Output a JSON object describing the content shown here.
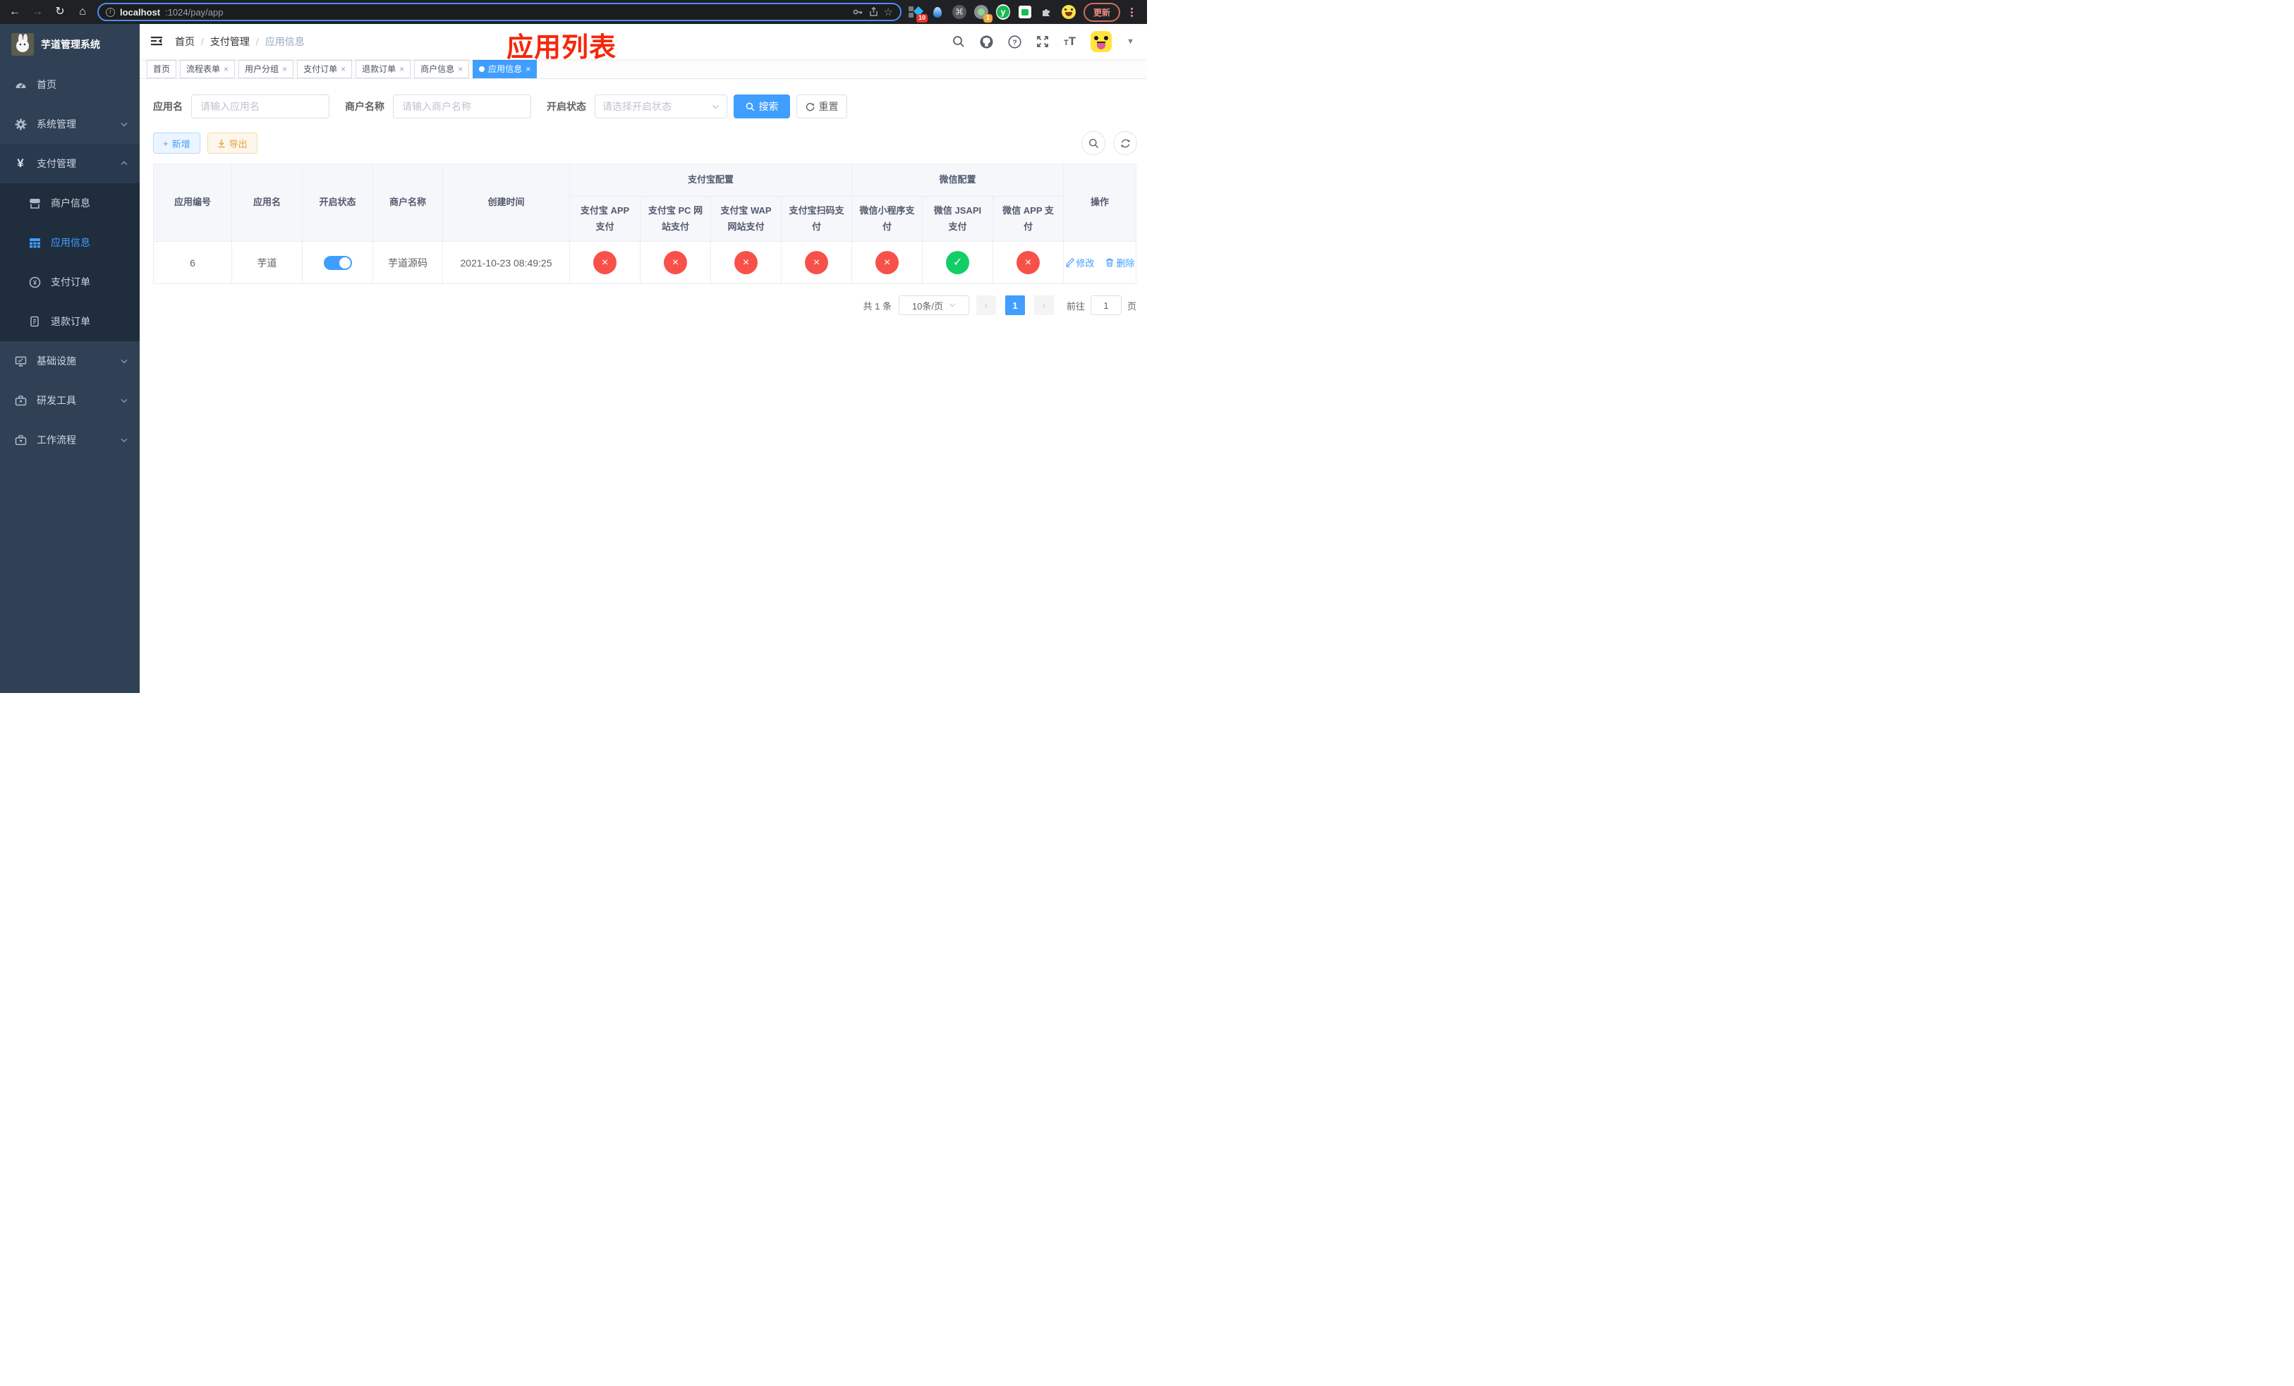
{
  "colors": {
    "accent": "#409eff",
    "annotation_red": "#f5270b",
    "status_cross": "#f8514a",
    "status_check": "#13ce66",
    "sidebar_bg": "#304156",
    "submenu_bg": "#1f2d3d",
    "update_red": "#f08e84"
  },
  "icons": {
    "back": "←",
    "forward": "→",
    "reload": "↻",
    "home": "⌂",
    "star": "☆",
    "command": "⌘",
    "info": "i",
    "close": "×",
    "check": "✓",
    "cross": "×",
    "caret": "▼",
    "question": "?",
    "plus": "+",
    "yen": "¥",
    "ext_y": "y",
    "chev_left": "‹",
    "chev_right": "›",
    "font_big": "T",
    "font_small": "T"
  },
  "browser": {
    "url_host": "localhost",
    "url_path": ":1024/pay/app",
    "update_label": "更新",
    "ext_badge_tasks": "10",
    "ext_badge_cam": "1"
  },
  "sidebar": {
    "title": "芋道管理系统",
    "menu": [
      {
        "label": "首页"
      },
      {
        "label": "系统管理"
      },
      {
        "label": "支付管理"
      },
      {
        "label": "商户信息"
      },
      {
        "label": "应用信息"
      },
      {
        "label": "支付订单"
      },
      {
        "label": "退款订单"
      },
      {
        "label": "基础设施"
      },
      {
        "label": "研发工具"
      },
      {
        "label": "工作流程"
      }
    ]
  },
  "breadcrumb": {
    "sep": "/",
    "home": "首页",
    "section": "支付管理",
    "current": "应用信息"
  },
  "annotation": "应用列表",
  "tabs": {
    "items": [
      {
        "label": "首页"
      },
      {
        "label": "流程表单"
      },
      {
        "label": "用户分组"
      },
      {
        "label": "支付订单"
      },
      {
        "label": "退款订单"
      },
      {
        "label": "商户信息"
      },
      {
        "label": "应用信息"
      }
    ]
  },
  "filters": {
    "app_name_label": "应用名",
    "app_name_placeholder": "请输入应用名",
    "merchant_label": "商户名称",
    "merchant_placeholder": "请输入商户名称",
    "status_label": "开启状态",
    "status_placeholder": "请选择开启状态",
    "search_label": "搜索",
    "reset_label": "重置"
  },
  "toolbar": {
    "add_label": "新增",
    "export_label": "导出"
  },
  "table": {
    "col_app_id": "应用编号",
    "col_app_name": "应用名",
    "col_status": "开启状态",
    "col_merchant": "商户名称",
    "col_create_time": "创建时间",
    "group_alipay": "支付宝配置",
    "group_wechat": "微信配置",
    "col_alipay_app": "支付宝 APP 支付",
    "col_alipay_pc": "支付宝 PC 网站支付",
    "col_alipay_wap": "支付宝 WAP 网站支付",
    "col_alipay_qr": "支付宝扫码支付",
    "col_wx_mini": "微信小程序支付",
    "col_wx_jsapi": "微信 JSAPI 支付",
    "col_wx_app": "微信 APP 支付",
    "col_actions": "操作",
    "row": {
      "id": "6",
      "name": "芋道",
      "switch_on": true,
      "merchant": "芋道源码",
      "created": "2021-10-23 08:49:25",
      "statuses": [
        "cross",
        "cross",
        "cross",
        "cross",
        "cross",
        "check",
        "cross"
      ],
      "edit_label": "修改",
      "delete_label": "删除"
    }
  },
  "pagination": {
    "total_text": "共 1 条",
    "page_size_text": "10条/页",
    "page": "1",
    "goto_label": "前往",
    "goto_value": "1",
    "unit_label": "页"
  }
}
